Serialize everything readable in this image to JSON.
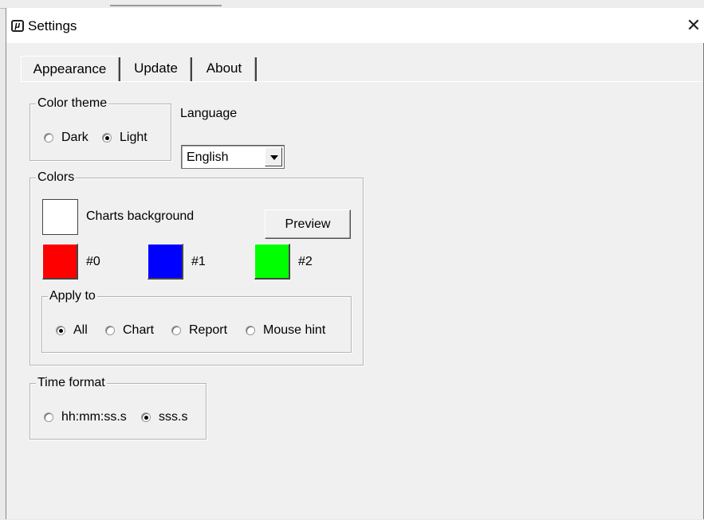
{
  "window": {
    "title": "Settings",
    "app_icon_glyph": "μ",
    "close_glyph": "✕"
  },
  "tabs": [
    {
      "label": "Appearance",
      "active": true
    },
    {
      "label": "Update",
      "active": false
    },
    {
      "label": "About",
      "active": false
    }
  ],
  "color_theme": {
    "legend": "Color theme",
    "options": [
      {
        "label": "Dark",
        "selected": false
      },
      {
        "label": "Light",
        "selected": true
      }
    ]
  },
  "language": {
    "label": "Language",
    "value": "English"
  },
  "colors": {
    "legend": "Colors",
    "background_label": "Charts background",
    "background_color": "#ffffff",
    "preview_label": "Preview",
    "swatches": [
      {
        "label": "#0",
        "color": "#ff0000"
      },
      {
        "label": "#1",
        "color": "#0000ff"
      },
      {
        "label": "#2",
        "color": "#00ff00"
      }
    ],
    "apply_to": {
      "legend": "Apply to",
      "options": [
        {
          "label": "All",
          "selected": true
        },
        {
          "label": "Chart",
          "selected": false
        },
        {
          "label": "Report",
          "selected": false
        },
        {
          "label": "Mouse hint",
          "selected": false
        }
      ]
    }
  },
  "time_format": {
    "legend": "Time format",
    "options": [
      {
        "label": "hh:mm:ss.s",
        "selected": false
      },
      {
        "label": "sss.s",
        "selected": true
      }
    ]
  }
}
